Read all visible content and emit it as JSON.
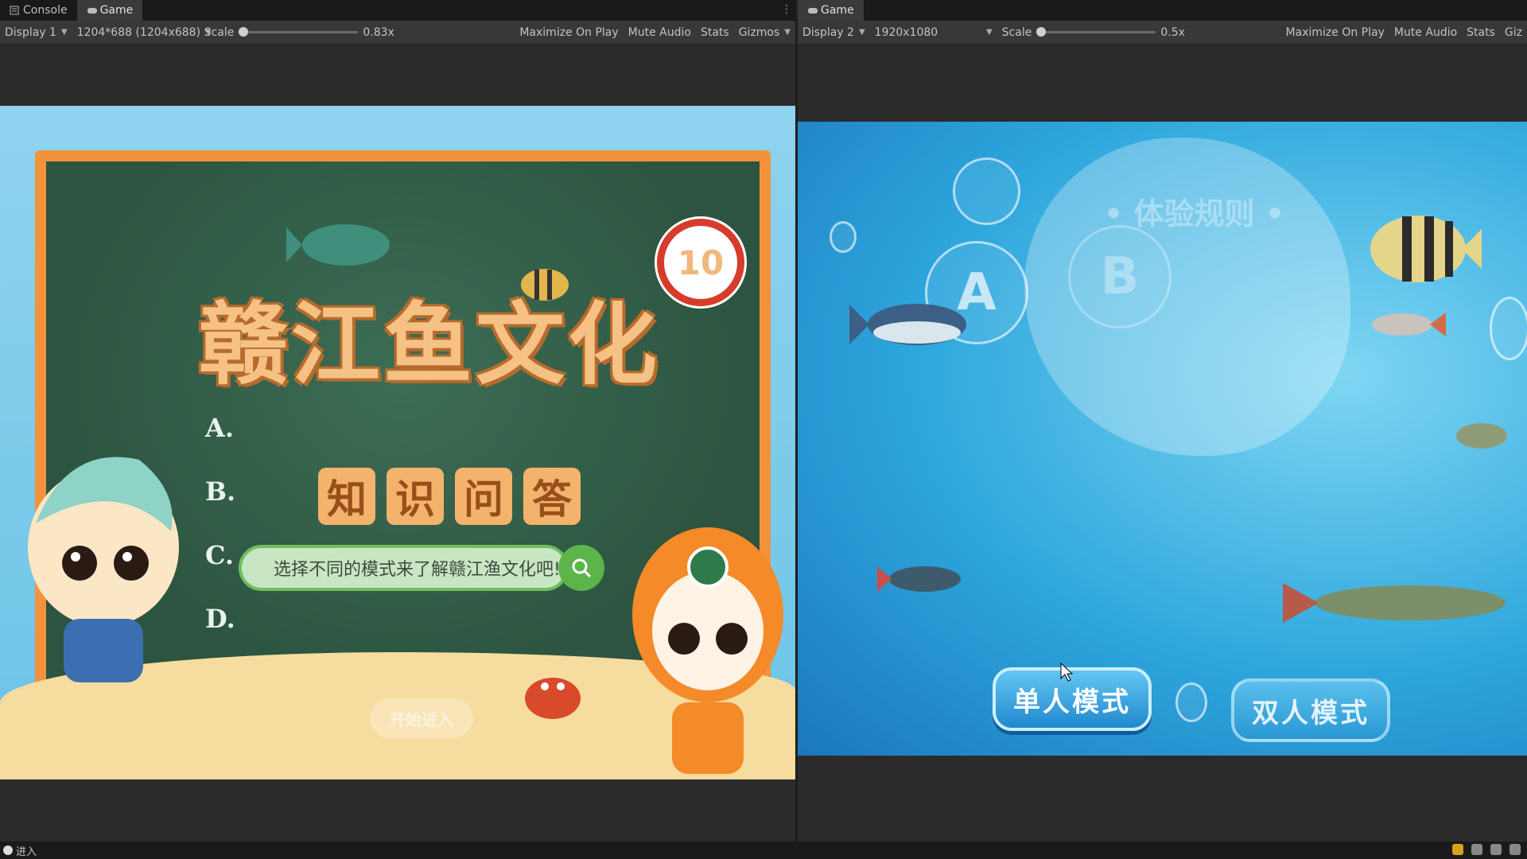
{
  "left": {
    "tabs": [
      {
        "label": "Console"
      },
      {
        "label": "Game"
      }
    ],
    "toolbar": {
      "display": "Display 1",
      "resolution": "1204*688 (1204x688)",
      "scale_label": "Scale",
      "scale_value": "0.83x",
      "maximize": "Maximize On Play",
      "mute": "Mute Audio",
      "stats": "Stats",
      "gizmos": "Gizmos"
    },
    "game": {
      "title": "赣江鱼文化",
      "subtitle": [
        "知",
        "识",
        "问",
        "答"
      ],
      "choices": [
        "A.",
        "B.",
        "C.",
        "D."
      ],
      "timer": "10",
      "search_text": "选择不同的模式来了解赣江渔文化吧!",
      "start_button": "开始进入"
    }
  },
  "right": {
    "tabs": [
      {
        "label": "Game"
      }
    ],
    "toolbar": {
      "display": "Display 2",
      "resolution": "1920x1080",
      "scale_label": "Scale",
      "scale_value": "0.5x",
      "maximize": "Maximize On Play",
      "mute": "Mute Audio",
      "stats": "Stats",
      "gizmos": "Giz"
    },
    "game": {
      "rules_title": "• 体验规则 •",
      "bubble_a": "A",
      "bubble_b": "B",
      "single_mode": "单人模式",
      "double_mode": "双人模式"
    }
  },
  "statusbar": {
    "message": "进入"
  },
  "colors": {
    "board": "#2f5a44",
    "frame": "#f2923a",
    "accent_blue": "#1f88cf",
    "timer_red": "#d73b2b"
  }
}
